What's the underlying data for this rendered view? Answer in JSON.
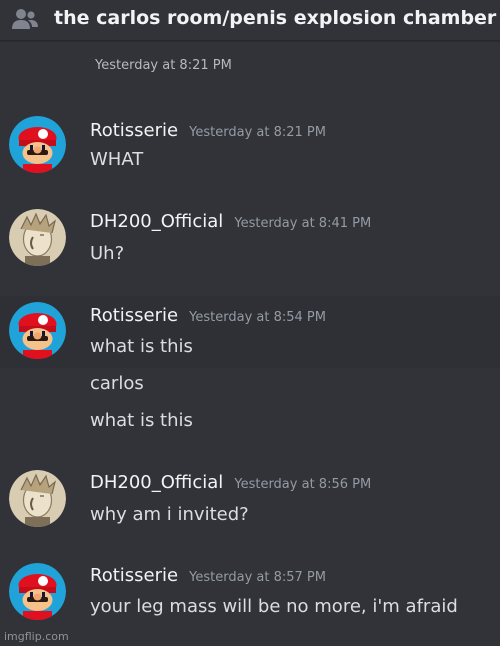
{
  "header": {
    "channel_icon": "people-icon",
    "title": "the carlos room/penis explosion chamber"
  },
  "system": {
    "timestamp": "Yesterday at 8:21 PM"
  },
  "messages": [
    {
      "author": "Rotisserie",
      "timestamp": "Yesterday at 8:21 PM",
      "avatar": "mario-avatar",
      "lines": [
        "WHAT"
      ]
    },
    {
      "author": "DH200_Official",
      "timestamp": "Yesterday at 8:41 PM",
      "avatar": "sketch-avatar",
      "lines": [
        "Uh?"
      ]
    },
    {
      "author": "Rotisserie",
      "timestamp": "Yesterday at 8:54 PM",
      "avatar": "mario-avatar",
      "lines": [
        "what is this",
        "carlos",
        "what is this"
      ]
    },
    {
      "author": "DH200_Official",
      "timestamp": "Yesterday at 8:56 PM",
      "avatar": "sketch-avatar",
      "lines": [
        "why am i invited?"
      ]
    },
    {
      "author": "Rotisserie",
      "timestamp": "Yesterday at 8:57 PM",
      "avatar": "mario-avatar",
      "lines": [
        "your leg mass will be no more, i'm afraid"
      ]
    }
  ],
  "watermark": "imgflip.com",
  "colors": {
    "background": "#313338",
    "highlight_row": "#2e3035",
    "text": "#dbdee1",
    "author": "#f2f3f5",
    "muted": "#949ba4",
    "mario_avatar_bg": "#1fa3d8"
  }
}
